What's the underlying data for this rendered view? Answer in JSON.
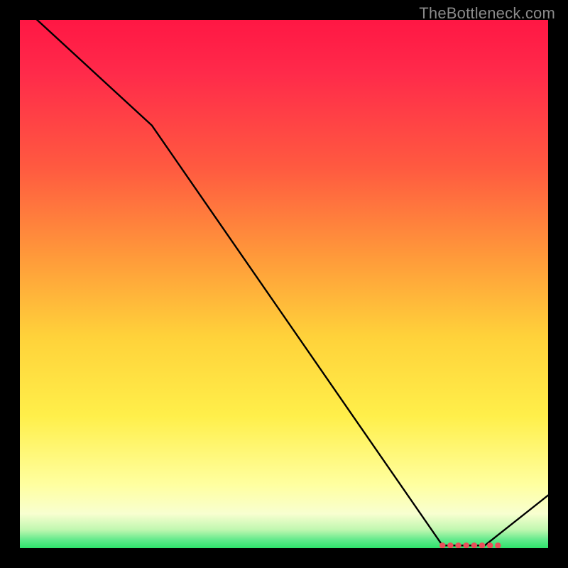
{
  "watermark": "TheBottleneck.com",
  "colors": {
    "background": "#000000",
    "line": "#000000",
    "marker": "#e94f5a",
    "gradient_top": "#ff1744",
    "gradient_mid1": "#ff8a3d",
    "gradient_mid2": "#ffe24a",
    "gradient_mid3": "#ffff8a",
    "gradient_bottom": "#2ee26b"
  },
  "chart_data": {
    "type": "line",
    "title": "",
    "xlabel": "",
    "ylabel": "",
    "xlim": [
      0,
      100
    ],
    "ylim": [
      0,
      100
    ],
    "series": [
      {
        "name": "curve",
        "x": [
          0,
          25,
          80,
          88,
          100
        ],
        "y": [
          103,
          80,
          0.5,
          0.5,
          10
        ]
      }
    ],
    "markers": {
      "name": "bottom-cluster",
      "points": [
        {
          "x": 80,
          "y": 0.5
        },
        {
          "x": 81.5,
          "y": 0.5
        },
        {
          "x": 83,
          "y": 0.5
        },
        {
          "x": 84.5,
          "y": 0.5
        },
        {
          "x": 86,
          "y": 0.5
        },
        {
          "x": 87.5,
          "y": 0.5
        },
        {
          "x": 89,
          "y": 0.5
        },
        {
          "x": 90.5,
          "y": 0.5
        }
      ]
    },
    "gradient_stops": [
      {
        "offset": 0.0,
        "color": "#ff1744"
      },
      {
        "offset": 0.1,
        "color": "#ff2a4a"
      },
      {
        "offset": 0.28,
        "color": "#ff5a40"
      },
      {
        "offset": 0.45,
        "color": "#ff9a3a"
      },
      {
        "offset": 0.6,
        "color": "#ffd23a"
      },
      {
        "offset": 0.75,
        "color": "#ffef4a"
      },
      {
        "offset": 0.88,
        "color": "#ffffa0"
      },
      {
        "offset": 0.935,
        "color": "#f8ffd0"
      },
      {
        "offset": 0.965,
        "color": "#c0f7b0"
      },
      {
        "offset": 0.985,
        "color": "#5fe98a"
      },
      {
        "offset": 1.0,
        "color": "#2ee26b"
      }
    ]
  }
}
